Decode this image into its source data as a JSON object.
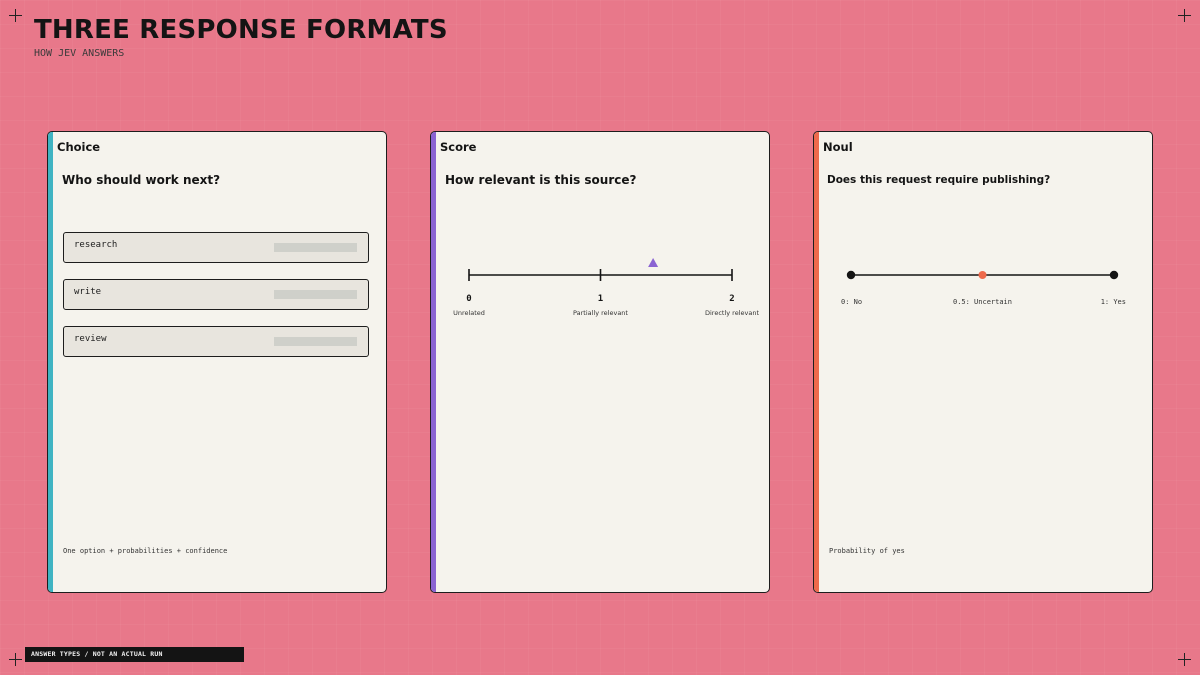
{
  "header": {
    "title": "THREE RESPONSE FORMATS",
    "subtitle": "HOW JEV ANSWERS"
  },
  "colors": {
    "background": "#e8788a",
    "panel": "#f5f3ed",
    "choice_accent": "#3fb3c2",
    "score_accent": "#8a63d2",
    "noul_accent": "#ee6a4c",
    "ink": "#141414"
  },
  "panels": {
    "choice": {
      "label": "Choice",
      "question": "Who should work next?",
      "options": [
        "research",
        "write",
        "review"
      ],
      "footnote": "One option + probabilities + confidence"
    },
    "score": {
      "label": "Score",
      "question": "How relevant is this source?",
      "ticks": [
        {
          "value": "0",
          "caption": "Unrelated"
        },
        {
          "value": "1",
          "caption": "Partially relevant"
        },
        {
          "value": "2",
          "caption": "Directly relevant"
        }
      ],
      "marker_value": 1.4,
      "marker_icon": "triangle-marker-icon"
    },
    "noul": {
      "label": "Noul",
      "question": "Does this request require publishing?",
      "points": [
        "0: No",
        "0.5: Uncertain",
        "1: Yes"
      ],
      "highlight_value": 0.5,
      "footnote": "Probability of yes"
    }
  },
  "footer": {
    "label": "ANSWER TYPES / NOT AN ACTUAL RUN"
  }
}
